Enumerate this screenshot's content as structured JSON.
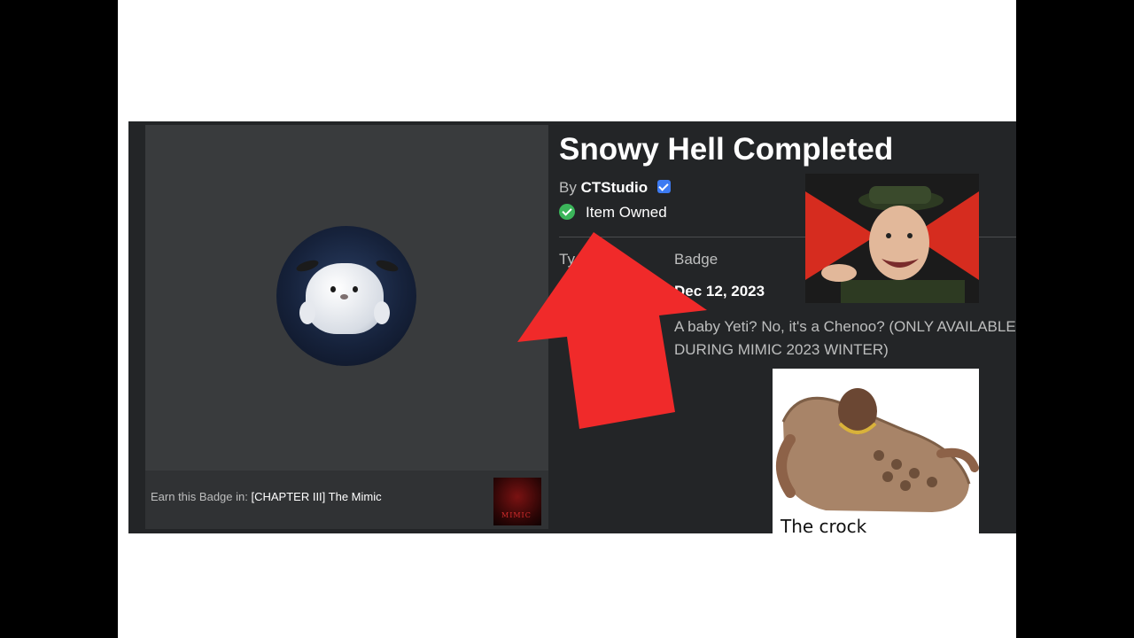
{
  "badge": {
    "title": "Snowy Hell Completed",
    "by_prefix": "By",
    "creator": "CTStudio",
    "ownership": "Item Owned",
    "type_label": "Ty",
    "type_value": "Badge",
    "date_value": "Dec 12, 2023",
    "description": "A baby Yeti? No, it's a Chenoo? (ONLY AVAILABLE DURING MIMIC 2023 WINTER)"
  },
  "earn": {
    "prefix": "Earn this Badge in:",
    "game_name": "[CHAPTER III] The Mimic",
    "game_thumb_text": "MIMIC"
  },
  "overlays": {
    "crock_caption": "The crock"
  },
  "colors": {
    "panel_bg": "#232527",
    "card_bg": "#393b3d",
    "arrow": "#f02a2a",
    "verified": "#3d7bf2",
    "owned_check": "#3bb55a"
  },
  "icons": [
    "verified-badge-icon",
    "check-circle-icon"
  ]
}
